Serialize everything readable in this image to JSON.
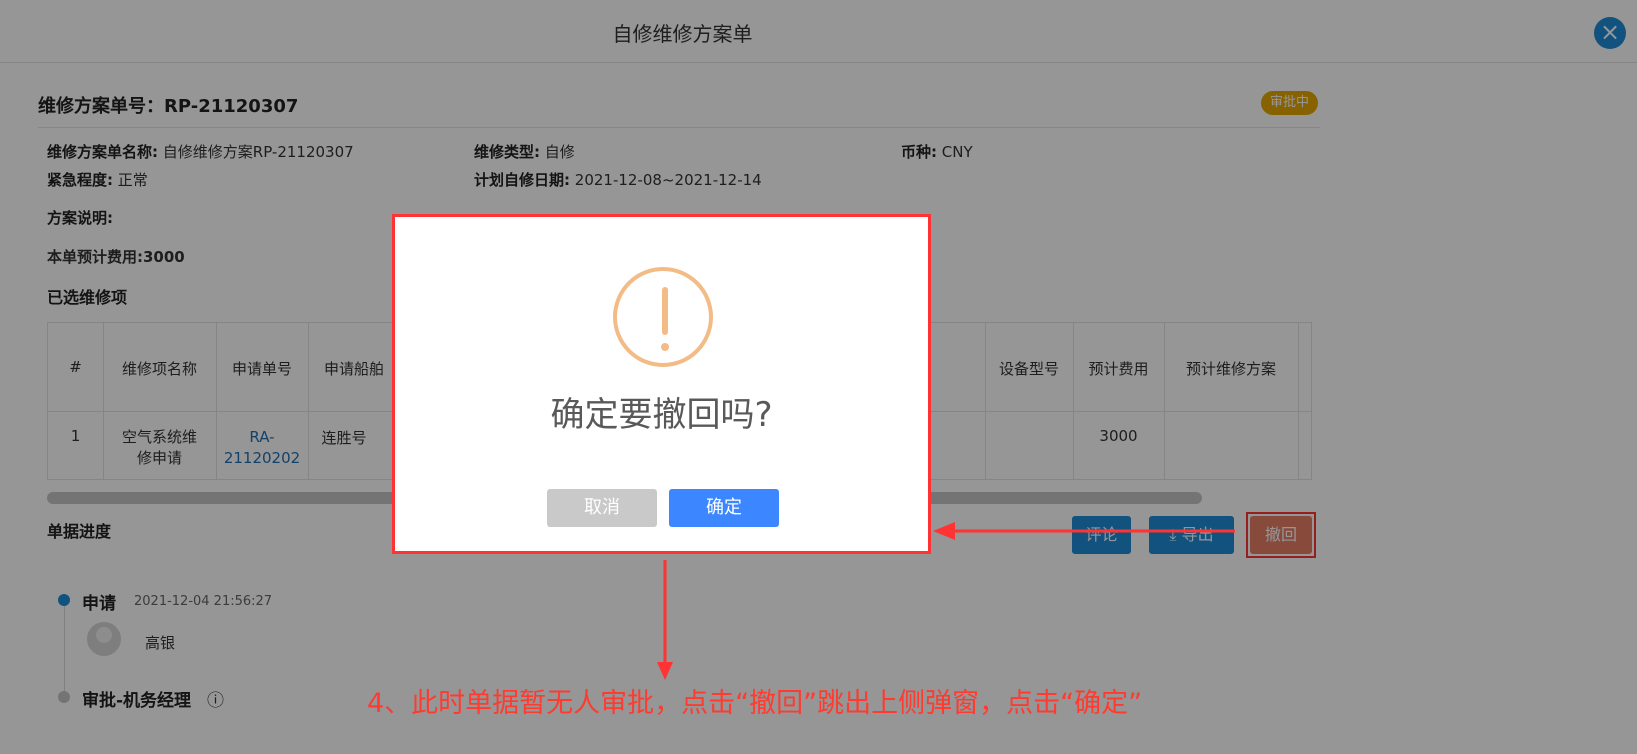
{
  "window": {
    "title": "自修维修方案单"
  },
  "doc": {
    "number_label": "维修方案单号：RP-21120307",
    "status": "审批中",
    "fields": {
      "name_label": "维修方案单名称:",
      "name_value": "自修维修方案RP-21120307",
      "type_label": "维修类型:",
      "type_value": "自修",
      "currency_label": "币种:",
      "currency_value": "CNY",
      "urgency_label": "紧急程度:",
      "urgency_value": "正常",
      "date_label": "计划自修日期:",
      "date_value": "2021-12-08~2021-12-14",
      "desc_label": "方案说明:",
      "cost_label": "本单预计费用:3000"
    }
  },
  "table": {
    "section_title": "已选维修项",
    "headers": [
      "#",
      "维修项名称",
      "申请单号",
      "申请船舶",
      "设备型号",
      "预计费用",
      "预计维修方案"
    ],
    "row": {
      "index": "1",
      "name_line1": "空气系统维",
      "name_line2": "修申请",
      "request_no_line1": "RA-",
      "request_no_line2": "21120202",
      "ship": "连胜号",
      "cost": "3000"
    }
  },
  "progress": {
    "title": "单据进度",
    "step1_name": "申请",
    "step1_time": "2021-12-04 21:56:27",
    "step1_user": "高银",
    "step2_name": "审批-机务经理",
    "info_icon": "ⓘ"
  },
  "actions": {
    "comment": "评论",
    "export": "导出",
    "withdraw": "撤回"
  },
  "modal": {
    "message": "确定要撤回吗?",
    "cancel": "取消",
    "confirm": "确定"
  },
  "annotation": "4、此时单据暂无人审批，点击“撤回”跳出上侧弹窗，点击“确定”",
  "colors": {
    "primary": "#1e8ed6",
    "confirm": "#3c87ff",
    "warning": "#e6a700",
    "withdraw": "#e87e64",
    "annotation": "#ff3b30"
  }
}
